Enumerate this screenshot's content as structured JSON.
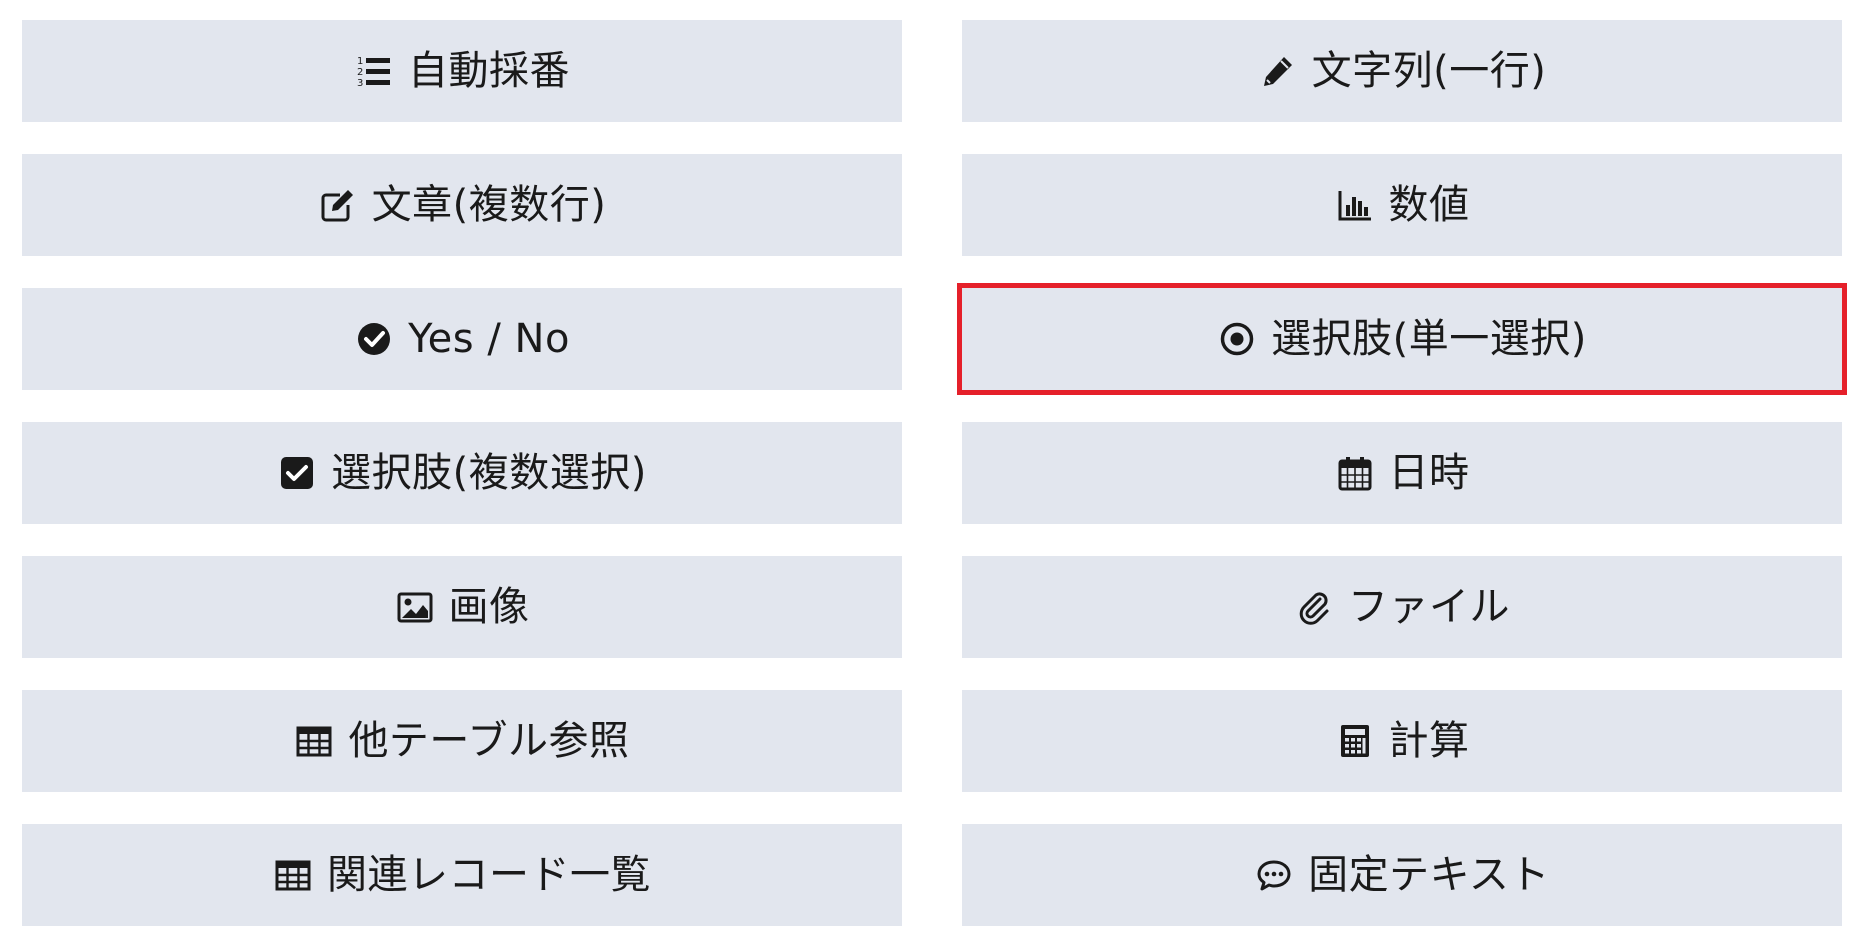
{
  "field_types": {
    "left": [
      {
        "label": "自動採番",
        "icon": "list-ol-icon"
      },
      {
        "label": "文章(複数行)",
        "icon": "edit-icon"
      },
      {
        "label": "Yes / No",
        "icon": "check-circle-icon"
      },
      {
        "label": "選択肢(複数選択)",
        "icon": "check-square-icon"
      },
      {
        "label": "画像",
        "icon": "image-icon"
      },
      {
        "label": "他テーブル参照",
        "icon": "table-icon"
      },
      {
        "label": "関連レコード一覧",
        "icon": "table-icon"
      }
    ],
    "right": [
      {
        "label": "文字列(一行)",
        "icon": "pencil-icon"
      },
      {
        "label": "数値",
        "icon": "bar-chart-icon"
      },
      {
        "label": "選択肢(単一選択)",
        "icon": "dot-circle-icon",
        "selected": true
      },
      {
        "label": "日時",
        "icon": "calendar-icon"
      },
      {
        "label": "ファイル",
        "icon": "paperclip-icon"
      },
      {
        "label": "計算",
        "icon": "calculator-icon"
      },
      {
        "label": "固定テキスト",
        "icon": "comment-dots-icon"
      }
    ]
  },
  "colors": {
    "button_background": "#e2e6ee",
    "selected_outline": "#e5202a",
    "text": "#1a1a1a"
  }
}
